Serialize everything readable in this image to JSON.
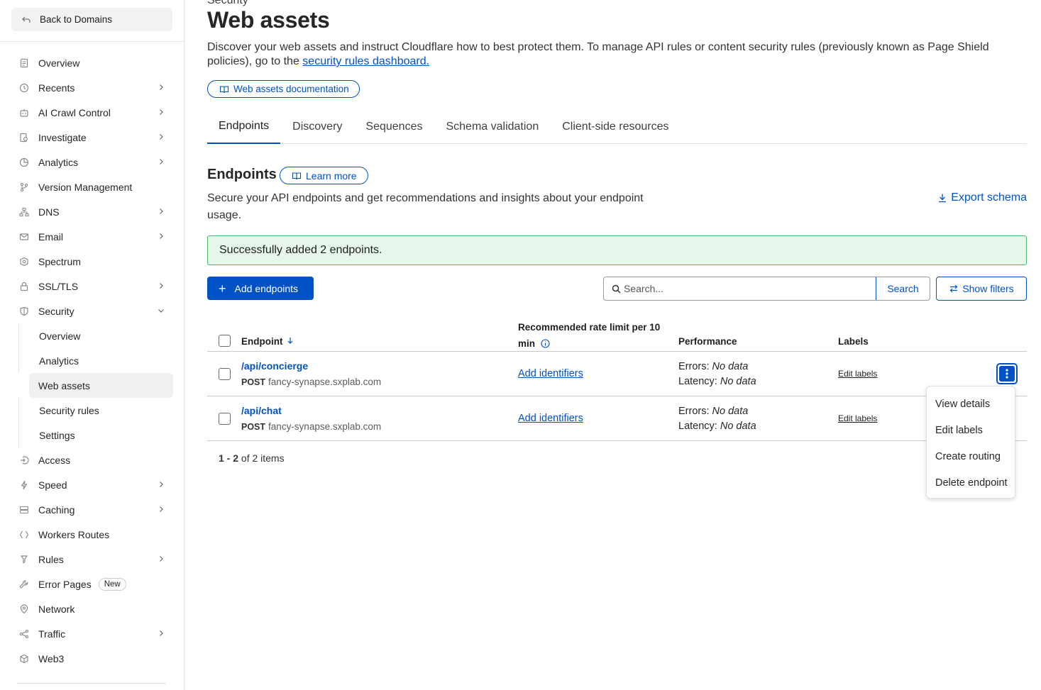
{
  "sidebar": {
    "back_label": "Back to Domains",
    "items": [
      {
        "label": "Overview",
        "icon": "document-icon",
        "chevron": false
      },
      {
        "label": "Recents",
        "icon": "clock-icon",
        "chevron": true
      },
      {
        "label": "AI Crawl Control",
        "icon": "robot-icon",
        "chevron": true
      },
      {
        "label": "Investigate",
        "icon": "investigate-icon",
        "chevron": true
      },
      {
        "label": "Analytics",
        "icon": "chart-icon",
        "chevron": true
      },
      {
        "label": "Version Management",
        "icon": "branch-icon",
        "chevron": false
      },
      {
        "label": "DNS",
        "icon": "network-tree-icon",
        "chevron": true
      },
      {
        "label": "Email",
        "icon": "mail-icon",
        "chevron": true
      },
      {
        "label": "Spectrum",
        "icon": "spectrum-icon",
        "chevron": false
      },
      {
        "label": "SSL/TLS",
        "icon": "lock-icon",
        "chevron": true
      },
      {
        "label": "Security",
        "icon": "shield-icon",
        "chevron": "down"
      }
    ],
    "security_sub": [
      "Overview",
      "Analytics",
      "Web assets",
      "Security rules",
      "Settings"
    ],
    "items_after": [
      {
        "label": "Access",
        "icon": "access-icon",
        "chevron": false
      },
      {
        "label": "Speed",
        "icon": "bolt-icon",
        "chevron": true
      },
      {
        "label": "Caching",
        "icon": "server-icon",
        "chevron": true
      },
      {
        "label": "Workers Routes",
        "icon": "workers-icon",
        "chevron": false
      },
      {
        "label": "Rules",
        "icon": "rules-icon",
        "chevron": true
      },
      {
        "label": "Error Pages",
        "icon": "wrench-icon",
        "chevron": false,
        "badge": "New"
      },
      {
        "label": "Network",
        "icon": "pin-icon",
        "chevron": false
      },
      {
        "label": "Traffic",
        "icon": "traffic-icon",
        "chevron": true
      },
      {
        "label": "Web3",
        "icon": "web3-icon",
        "chevron": false
      }
    ]
  },
  "main": {
    "breadcrumb": "Security",
    "title": "Web assets",
    "description_prefix": "Discover your web assets and instruct Cloudflare how to best protect them. To manage API rules or content security rules (previously known as Page Shield policies), go to the ",
    "description_link": "security rules dashboard.",
    "docs_label": "Web assets documentation",
    "tabs": [
      "Endpoints",
      "Discovery",
      "Sequences",
      "Schema validation",
      "Client-side resources"
    ],
    "active_tab": "Endpoints",
    "section_title": "Endpoints",
    "learn_more": "Learn more",
    "section_desc": "Secure your API endpoints and get recommendations and insights about your endpoint usage.",
    "export_label": "Export schema",
    "alert": "Successfully added 2 endpoints.",
    "add_button": "Add endpoints",
    "search_placeholder": "Search...",
    "search_button": "Search",
    "filters_button": "Show filters",
    "table": {
      "headers": {
        "endpoint": "Endpoint",
        "rate_limit_line1": "Recommended rate limit per 10",
        "rate_limit_line2": "min",
        "performance": "Performance",
        "labels": "Labels"
      },
      "rows": [
        {
          "path": "/api/concierge",
          "method": "POST",
          "host": "fancy-synapse.sxplab.com",
          "rate": "Add identifiers",
          "errors_label": "Errors:",
          "errors": "No data",
          "latency_label": "Latency:",
          "latency": "No data",
          "labels": "Edit labels"
        },
        {
          "path": "/api/chat",
          "method": "POST",
          "host": "fancy-synapse.sxplab.com",
          "rate": "Add identifiers",
          "errors_label": "Errors:",
          "errors": "No data",
          "latency_label": "Latency:",
          "latency": "No data",
          "labels": "Edit labels"
        }
      ],
      "pager_range": "1 - 2",
      "pager_suffix": "of 2 items"
    },
    "row_menu": [
      "View details",
      "Edit labels",
      "Create routing",
      "Delete endpoint"
    ]
  },
  "colors": {
    "accent": "#0051c3",
    "success_bg": "#e6f6ea",
    "success_border": "#4cba6a"
  }
}
